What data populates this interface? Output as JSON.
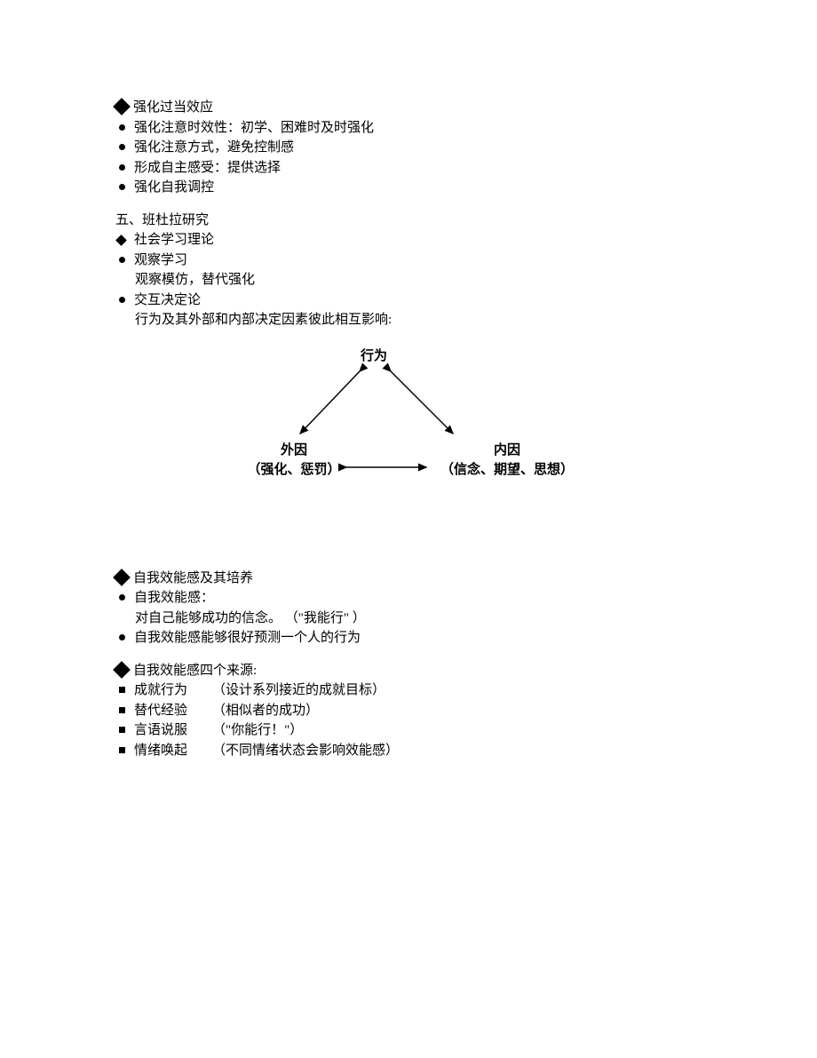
{
  "section1": {
    "title": "强化过当效应",
    "items": [
      "强化注意时效性：初学、困难时及时强化",
      "强化注意方式，避免控制感",
      "形成自主感受：提供选择",
      "强化自我调控"
    ]
  },
  "section2": {
    "title": "五、班杜拉研究",
    "diamond": "社会学习理论",
    "item1": "观察学习",
    "item1_sub": "观察模仿，替代强化",
    "item2": "交互决定论",
    "item2_sub": "行为及其外部和内部决定因素彼此相互影响:"
  },
  "diagram": {
    "top": "行为",
    "left_label": "外因",
    "left_sub": "（强化、惩罚）",
    "right_label": "内因",
    "right_sub": "（信念、期望、思想）"
  },
  "section3": {
    "title": "自我效能感及其培养",
    "item1": "自我效能感：",
    "item1_sub": "对自己能够成功的信念。  （\"我能行\"  ）",
    "item2": "自我效能感能够很好预测一个人的行为"
  },
  "section4": {
    "title": "自我效能感四个来源:",
    "items": [
      {
        "label": "成就行为",
        "desc": "（设计系列接近的成就目标）"
      },
      {
        "label": "替代经验",
        "desc": "（相似者的成功）"
      },
      {
        "label": "言语说服",
        "desc": "（\"你能行！\"）"
      },
      {
        "label": "情绪唤起",
        "desc": "（不同情绪状态会影响效能感）"
      }
    ]
  }
}
